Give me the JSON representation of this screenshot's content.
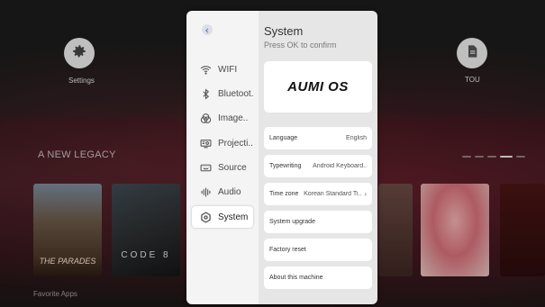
{
  "launcher": {
    "tiles": [
      {
        "label": "Settings",
        "icon": "gear-icon"
      },
      {
        "label": "TOU",
        "icon": "document-icon"
      }
    ],
    "hero_text": "A NEW LEGACY",
    "section_label": "Favorite Apps",
    "posters": [
      {
        "title": "THE PARADES"
      },
      {
        "title": "CODE 8"
      },
      {
        "title": ""
      },
      {
        "title": ""
      },
      {
        "title": ""
      }
    ]
  },
  "dialog": {
    "back_icon": "chevron-left-icon",
    "menu": [
      {
        "label": "WIFI",
        "icon": "wifi-icon",
        "active": false
      },
      {
        "label": "Bluetoot..",
        "icon": "bluetooth-icon",
        "active": false
      },
      {
        "label": "Image..",
        "icon": "palette-icon",
        "active": false
      },
      {
        "label": "Projecti..",
        "icon": "projector-icon",
        "active": false
      },
      {
        "label": "Source",
        "icon": "keyboard-icon",
        "active": false
      },
      {
        "label": "Audio",
        "icon": "audio-bars-icon",
        "active": false
      },
      {
        "label": "System",
        "icon": "system-gear-icon",
        "active": true
      }
    ],
    "title": "System",
    "subtitle": "Press OK to confirm",
    "logo": "AUMI OS",
    "rows": [
      {
        "label": "Language",
        "value": "English",
        "chevron": false
      },
      {
        "label": "Typewriting",
        "value": "Android Keyboard..",
        "chevron": false
      },
      {
        "label": "Time zone",
        "value": "Korean Standard Ti..",
        "chevron": true
      },
      {
        "label": "System upgrade",
        "value": "",
        "chevron": false
      },
      {
        "label": "Factory reset",
        "value": "",
        "chevron": false
      },
      {
        "label": "About this machine",
        "value": "",
        "chevron": false
      }
    ],
    "colors": {
      "left_pane": "#f4f4f4",
      "right_pane": "#e6e6e6",
      "card": "#ffffff"
    }
  }
}
